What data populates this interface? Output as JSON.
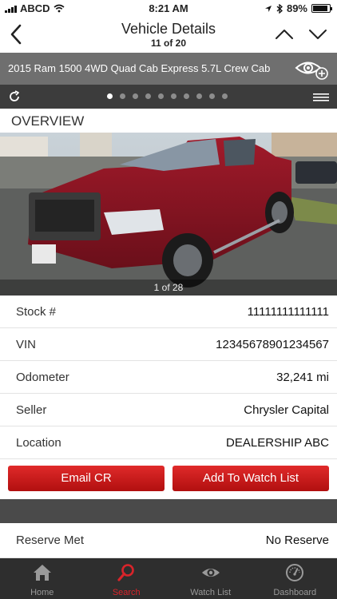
{
  "status_bar": {
    "carrier": "ABCD",
    "time": "8:21 AM",
    "battery": "89%",
    "battery_level": 0.89
  },
  "nav": {
    "title": "Vehicle Details",
    "position": "11 of 20"
  },
  "vehicle": {
    "name": "2015 Ram 1500 4WD Quad Cab Express 5.7L Crew Cab"
  },
  "carousel": {
    "dot_count": 10,
    "active_index": 0
  },
  "section": {
    "title": "OVERVIEW"
  },
  "photo": {
    "counter": "1 of 28"
  },
  "details": [
    {
      "label": "Stock #",
      "value": "11111111111111"
    },
    {
      "label": "VIN",
      "value": "12345678901234567"
    },
    {
      "label": "Odometer",
      "value": "32,241 mi"
    },
    {
      "label": "Seller",
      "value": "Chrysler Capital"
    },
    {
      "label": "Location",
      "value": "DEALERSHIP ABC"
    }
  ],
  "buttons": {
    "email": "Email CR",
    "watchlist": "Add To Watch List"
  },
  "reserve": {
    "label": "Reserve Met",
    "value": "No Reserve"
  },
  "tabs": [
    {
      "label": "Home",
      "icon": "home-icon"
    },
    {
      "label": "Search",
      "icon": "search-icon",
      "active": true
    },
    {
      "label": "Watch List",
      "icon": "eye-icon"
    },
    {
      "label": "Dashboard",
      "icon": "gauge-icon"
    }
  ],
  "colors": {
    "accent": "#d8242a",
    "tabbar": "#2e2e2e",
    "vehicle_bar": "#6f6f6f"
  }
}
